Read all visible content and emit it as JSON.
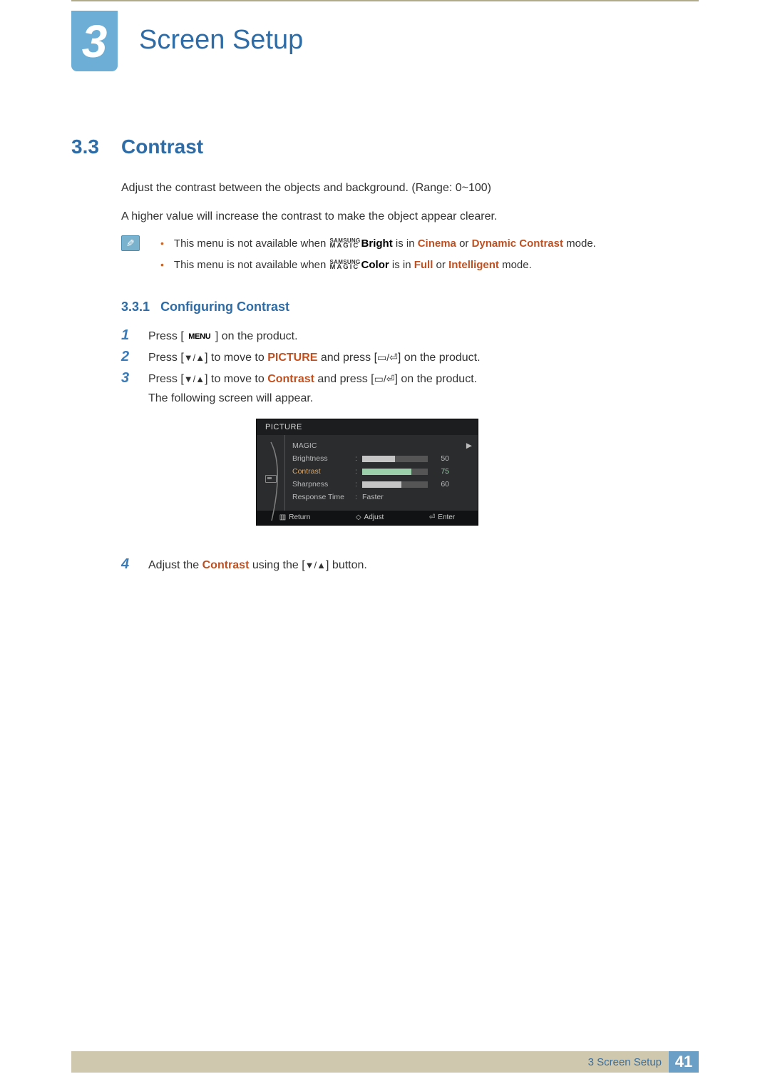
{
  "chapter": {
    "number": "3",
    "title": "Screen Setup"
  },
  "section": {
    "number": "3.3",
    "title": "Contrast"
  },
  "intro": {
    "line1": "Adjust the contrast between the objects and background. (Range: 0~100)",
    "line2": "A higher value will increase the contrast to make the object appear clearer."
  },
  "magic": {
    "top": "SAMSUNG",
    "bottom": "MAGIC"
  },
  "notes": {
    "n1_pre": "This menu is not available when ",
    "n1_feat": "Bright",
    "n1_mid": " is in ",
    "n1_m1": "Cinema",
    "n1_or": " or ",
    "n1_m2": "Dynamic Contrast",
    "n1_post": " mode.",
    "n2_pre": "This menu is not available when ",
    "n2_feat": "Color",
    "n2_mid": " is in ",
    "n2_m1": "Full",
    "n2_or": " or ",
    "n2_m2": "Intelligent",
    "n2_post": " mode."
  },
  "subsection": {
    "number": "3.3.1",
    "title": "Configuring Contrast"
  },
  "steps": {
    "menu_label": "MENU",
    "s1_a": "Press [ ",
    "s1_b": " ] on the product.",
    "s2_a": "Press [",
    "s2_arrows": "▼/▲",
    "s2_b": "] to move to ",
    "s2_target": "PICTURE",
    "s2_c": " and press [",
    "s2_enter": "▭/⏎",
    "s2_d": "] on the product.",
    "s3_a": "Press [",
    "s3_b": "] to move to ",
    "s3_target": "Contrast",
    "s3_c": " and press [",
    "s3_d": "] on the product.",
    "s3_next": "The following screen will appear.",
    "s4_a": "Adjust the ",
    "s4_target": "Contrast",
    "s4_b": " using the [",
    "s4_c": "] button."
  },
  "osd": {
    "header": "PICTURE",
    "rows": {
      "magic": {
        "label": "MAGIC"
      },
      "brightness": {
        "label": "Brightness",
        "value": 50,
        "max": 100
      },
      "contrast": {
        "label": "Contrast",
        "value": 75,
        "max": 100
      },
      "sharpness": {
        "label": "Sharpness",
        "value": 60,
        "max": 100
      },
      "response": {
        "label": "Response Time",
        "value": "Faster"
      }
    },
    "footer": {
      "return": "Return",
      "adjust": "Adjust",
      "enter": "Enter"
    }
  },
  "footer": {
    "breadcrumb": "3 Screen Setup",
    "page": "41"
  }
}
